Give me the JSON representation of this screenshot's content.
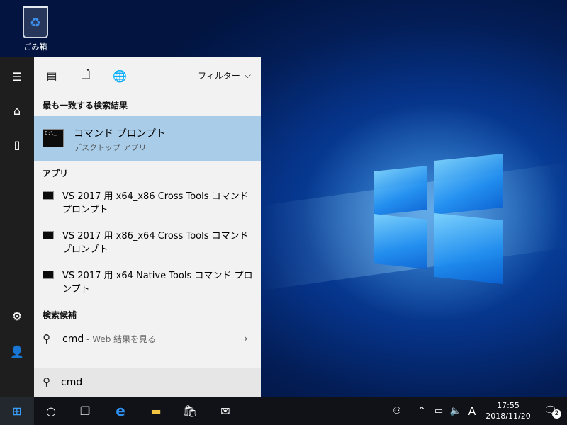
{
  "desktop": {
    "recycle_bin_label": "ごみ箱"
  },
  "start_rail": {
    "icons": [
      "hamburger-icon",
      "home-icon",
      "document-icon",
      "settings-icon",
      "person-icon"
    ]
  },
  "search_panel": {
    "filter_label": "フィルター",
    "best_match_header": "最も一致する検索結果",
    "best_match": {
      "title": "コマンド プロンプト",
      "subtitle": "デスクトップ アプリ"
    },
    "apps_header": "アプリ",
    "apps": [
      {
        "label": "VS 2017 用 x64_x86 Cross Tools コマンド プロンプト"
      },
      {
        "label": "VS 2017 用 x86_x64 Cross Tools コマンド プロンプト"
      },
      {
        "label": "VS 2017 用 x64 Native Tools コマンド プロンプト"
      }
    ],
    "suggestions_header": "検索候補",
    "suggestion": {
      "query": "cmd",
      "hint": " - Web 結果を見る"
    },
    "search_box_value": "cmd"
  },
  "taskbar": {
    "ime_indicator": "A",
    "clock_time": "17:55",
    "clock_date": "2018/11/20",
    "notification_count": "2"
  }
}
